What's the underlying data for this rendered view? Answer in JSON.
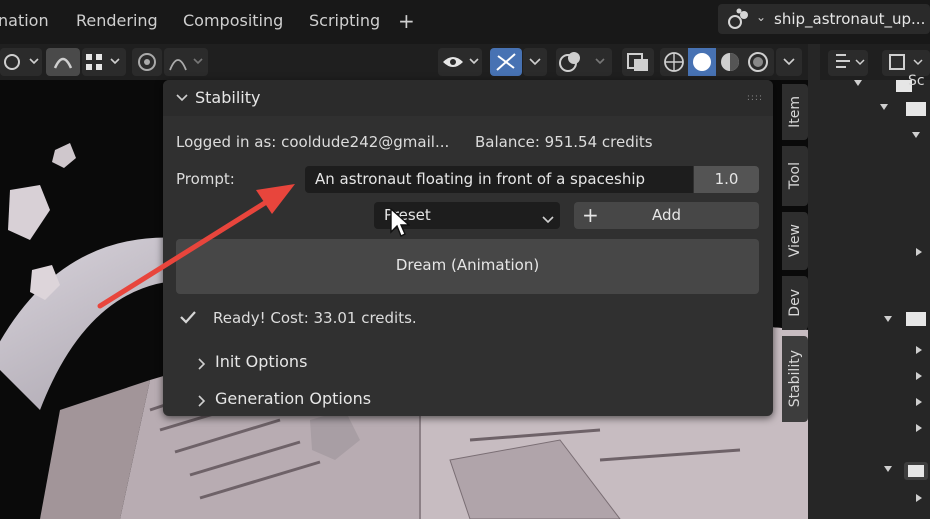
{
  "topbar": {
    "tabs": [
      "nation",
      "Rendering",
      "Compositing",
      "Scripting"
    ],
    "add_tab": "+",
    "scene_name": "ship_astronaut_up..."
  },
  "sidebar_tabs": [
    "Item",
    "Tool",
    "View",
    "Dev",
    "Stability"
  ],
  "outliner": {
    "scene_label": "Sc"
  },
  "panel": {
    "title": "Stability",
    "logged_in": "Logged in as: cooldude242@gmail...",
    "balance": "Balance: 951.54 credits",
    "prompt_label": "Prompt:",
    "prompt_value": "An astronaut floating in front of a spaceship",
    "prompt_strength": "1.0",
    "preset_value": "Preset",
    "add_label": "Add",
    "dream_label": "Dream (Animation)",
    "status": "Ready! Cost: 33.01 credits.",
    "init_options": "Init Options",
    "generation_options": "Generation Options"
  },
  "colors": {
    "accent_blue": "#4772b3",
    "annotation_arrow": "#e8453c",
    "panel_bg": "#303030"
  }
}
